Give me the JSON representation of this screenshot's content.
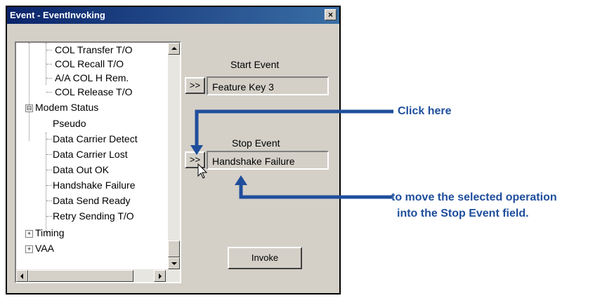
{
  "window": {
    "title": "Event - EventInvoking",
    "close_label": "×"
  },
  "tree": {
    "items": [
      {
        "label": "COL Transfer T/O"
      },
      {
        "label": "COL Recall T/O"
      },
      {
        "label": "A/A COL H Rem."
      },
      {
        "label": "COL Release T/O"
      },
      {
        "label": "Modem Status",
        "expander": "⊟"
      },
      {
        "label": "Pseudo"
      },
      {
        "label": "Data Carrier Detect"
      },
      {
        "label": "Data Carrier Lost"
      },
      {
        "label": "Data Out OK"
      },
      {
        "label": "Handshake Failure"
      },
      {
        "label": "Data Send Ready"
      },
      {
        "label": "Retry Sending T/O"
      },
      {
        "label": "Timing",
        "expander": "+"
      },
      {
        "label": "VAA",
        "expander": "+"
      }
    ]
  },
  "start_event": {
    "label": "Start Event",
    "button_label": ">>",
    "value": "Feature Key 3"
  },
  "stop_event": {
    "label": "Stop Event",
    "button_label": ">>",
    "value": "Handshake Failure"
  },
  "invoke_button": {
    "label": "Invoke"
  },
  "annotations": {
    "click_here": "Click here",
    "move_line1": "to move the selected operation",
    "move_line2": "into the Stop Event field."
  },
  "colors": {
    "callout": "#1f4e9c",
    "titlebar": "#0a246a"
  }
}
